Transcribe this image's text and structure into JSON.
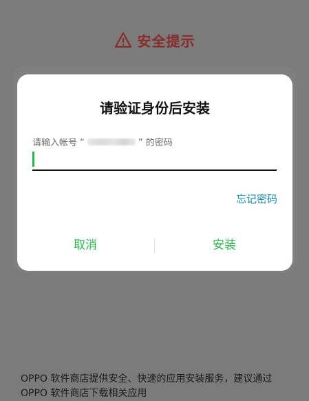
{
  "header": {
    "title": "安全提示",
    "icon": "warning-triangle-icon",
    "color": "#8a2a2a"
  },
  "dialog": {
    "title": "请验证身份后安装",
    "label_prefix": "请输入帐号 “",
    "label_suffix": "” 的密码",
    "forgot_password": "忘记密码",
    "cancel": "取消",
    "install": "安装",
    "accent": "#2bb24c"
  },
  "footer": {
    "text": "OPPO 软件商店提供安全、快速的应用安装服务，建议通过 OPPO 软件商店下载相关应用"
  }
}
